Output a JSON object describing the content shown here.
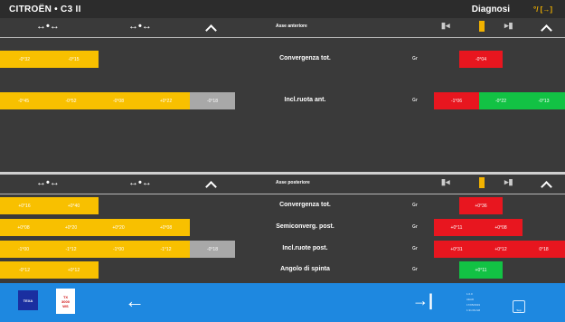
{
  "header": {
    "app_title": "CITROËN • C3 II",
    "mode": "Diagnosi",
    "unit": "°/ [→]"
  },
  "icons": {
    "wheel_lr": "↔•↔",
    "chevron": "chevron-up-icon"
  },
  "front": {
    "axle_label": "Asse anteriore",
    "rows": [
      {
        "label": "Convergenza tot.",
        "unit": "Gr",
        "vals": [
          "-0°32",
          "-0°15"
        ],
        "grey": "",
        "res": [
          {
            "v": "-0°04",
            "c": "red"
          }
        ]
      },
      {
        "label": "Incl.ruota ant.",
        "unit": "Gr",
        "vals": [
          "-0°45",
          "-0°52",
          "-0°08",
          "+0°22"
        ],
        "grey": "-0°18",
        "res": [
          {
            "v": "-1°06",
            "c": "red"
          },
          {
            "v": "-0°22",
            "c": "green"
          },
          {
            "v": "-0°13",
            "c": "green"
          }
        ]
      }
    ]
  },
  "rear": {
    "axle_label": "Asse posteriore",
    "rows": [
      {
        "label": "Convergenza tot.",
        "unit": "Gr",
        "vals": [
          "+0°16",
          "+0°40"
        ],
        "grey": "",
        "res": [
          {
            "v": "+0°36",
            "c": "red"
          }
        ]
      },
      {
        "label": "Semiconverg. post.",
        "unit": "Gr",
        "vals": [
          "+0°08",
          "+0°20",
          "+0°20",
          "+0°08"
        ],
        "grey": "",
        "res": [
          {
            "v": "+0°11",
            "c": "red"
          },
          {
            "v": "+0°08",
            "c": "red"
          }
        ]
      },
      {
        "label": "Incl.ruote post.",
        "unit": "Gr",
        "vals": [
          "-1°00",
          "-1°12",
          "-1°00",
          "-1°12"
        ],
        "grey": "-0°18",
        "res": [
          {
            "v": "+0°31",
            "c": "red"
          },
          {
            "v": "+0°12",
            "c": "red"
          },
          {
            "v": "0°18",
            "c": "red"
          }
        ]
      },
      {
        "label": "Angolo di spinta",
        "unit": "Gr",
        "vals": [
          "-0°12",
          "+0°12"
        ],
        "grey": "",
        "res": [
          {
            "v": "+0°11",
            "c": "green"
          }
        ]
      }
    ]
  },
  "footer": {
    "brand": "TEXA",
    "tag_lines": [
      "TX",
      "3000",
      "WS"
    ],
    "info_lines": [
      "1.0.0",
      "AEAD",
      "17/05/2019",
      "1:31:09 AM"
    ],
    "kb_label": "Sup"
  }
}
